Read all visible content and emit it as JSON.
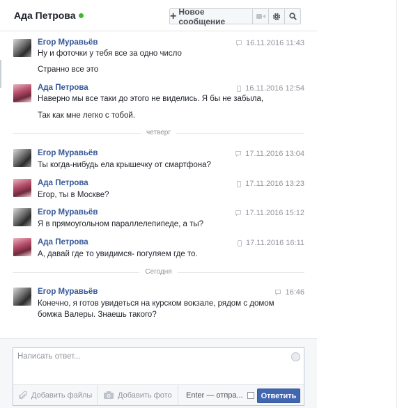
{
  "header": {
    "title": "Ада Петрова",
    "new_message_label": "Новое сообщение"
  },
  "messages": [
    {
      "author": "Егор Муравьёв",
      "time": "16.11.2016 11:43",
      "via": "web",
      "lines": [
        "Ну и фоточки у тебя все за одно число",
        "Странно все это"
      ]
    },
    {
      "author": "Ада Петрова",
      "time": "16.11.2016 12:54",
      "via": "mobile",
      "lines": [
        "Наверно мы все таки до этого не виделись. Я бы не забыла,",
        "Так как мне легко с тобой."
      ]
    },
    {
      "author": "Егор Муравьёв",
      "time": "17.11.2016 13:04",
      "via": "web",
      "lines": [
        "Ты когда-нибудь ела крышечку от смартфона?"
      ]
    },
    {
      "author": "Ада Петрова",
      "time": "17.11.2016 13:23",
      "via": "mobile",
      "lines": [
        "Егор, ты в Москве?"
      ]
    },
    {
      "author": "Егор Муравьёв",
      "time": "17.11.2016 15:12",
      "via": "web",
      "lines": [
        "Я в прямоугольном параллелепипеде, а ты?"
      ]
    },
    {
      "author": "Ада Петрова",
      "time": "17.11.2016 16:11",
      "via": "mobile",
      "lines": [
        "А, давай где то увидимся- погуляем где то."
      ]
    },
    {
      "author": "Егор Муравьёв",
      "time": "16:46",
      "via": "web",
      "lines": [
        "Конечно, я готов увидеться на курском вокзале, рядом с домом бомжа Валеры. Знаешь такого?"
      ]
    }
  ],
  "dividers": [
    "четверг",
    "Сегодня"
  ],
  "composer": {
    "placeholder": "Написать ответ...",
    "add_files": "Добавить файлы",
    "add_photo": "Добавить фото",
    "enter_send": "Enter — отпра...",
    "enter_send_checked": false,
    "send_label": "Ответить"
  },
  "colors": {
    "link": "#365899",
    "online": "#42b72a",
    "send_button": "#4267b2"
  }
}
